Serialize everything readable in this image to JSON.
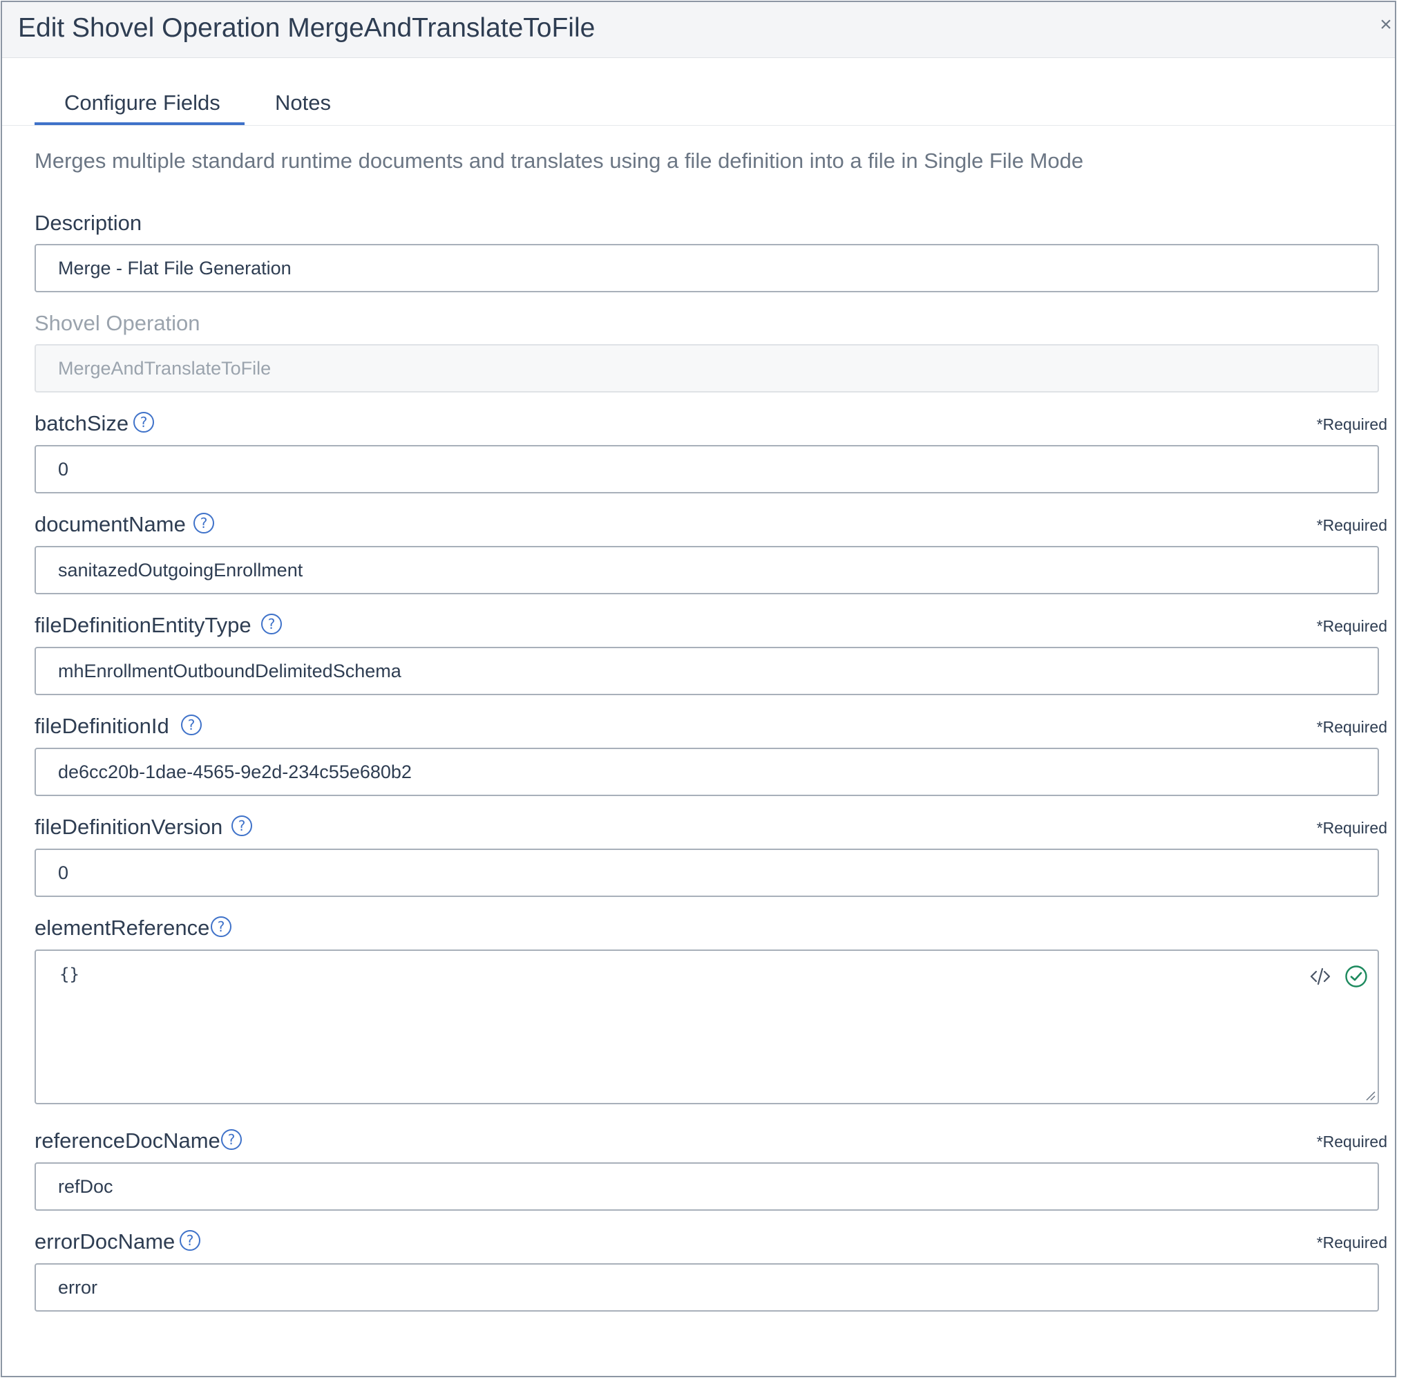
{
  "modal": {
    "title": "Edit Shovel Operation MergeAndTranslateToFile",
    "close_label": "×"
  },
  "tabs": [
    {
      "label": "Configure Fields",
      "active": true
    },
    {
      "label": "Notes",
      "active": false
    }
  ],
  "intro": "Merges multiple standard runtime documents and translates using a file definition into a file in Single File Mode",
  "required_label": "*Required",
  "fields": {
    "description": {
      "label": "Description",
      "value": "Merge - Flat File Generation"
    },
    "shovel_operation": {
      "label": "Shovel Operation",
      "value": "MergeAndTranslateToFile"
    },
    "batch_size": {
      "label": "batchSize",
      "value": "0"
    },
    "document_name": {
      "label": "documentName",
      "value": "sanitazedOutgoingEnrollment"
    },
    "file_definition_entity_type": {
      "label": "fileDefinitionEntityType",
      "value": "mhEnrollmentOutboundDelimitedSchema"
    },
    "file_definition_id": {
      "label": "fileDefinitionId",
      "value": "de6cc20b-1dae-4565-9e2d-234c55e680b2"
    },
    "file_definition_version": {
      "label": "fileDefinitionVersion",
      "value": "0"
    },
    "element_reference": {
      "label": "elementReference",
      "value": "{}"
    },
    "reference_doc_name": {
      "label": "referenceDocName",
      "value": "refDoc"
    },
    "error_doc_name": {
      "label": "errorDocName",
      "value": "error"
    }
  },
  "colors": {
    "accent": "#3f72c9",
    "valid": "#1d8a5e",
    "text": "#2e3d52",
    "muted": "#6b7684"
  },
  "icons": [
    "close-icon",
    "help-icon",
    "code-icon",
    "check-circle-icon",
    "resize-handle-icon"
  ]
}
